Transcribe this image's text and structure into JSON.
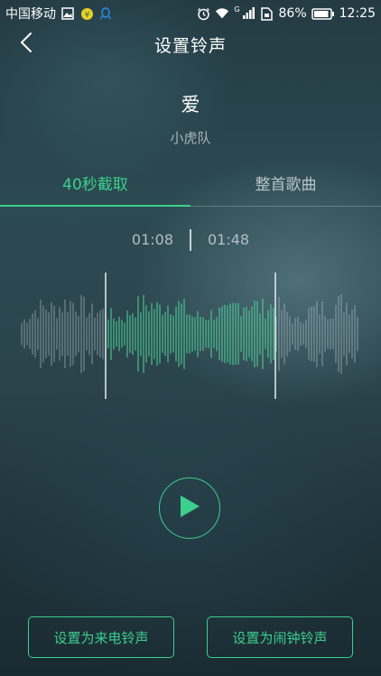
{
  "status_bar": {
    "carrier": "中国移动",
    "battery": "86%",
    "time": "12:25",
    "network_type": "G",
    "icons": [
      "image-icon",
      "coin-icon",
      "qq-icon",
      "alarm-icon",
      "wifi-icon",
      "signal-icon",
      "sim-icon",
      "battery-icon"
    ]
  },
  "nav": {
    "title": "设置铃声",
    "back_icon": "chevron-left-icon"
  },
  "song": {
    "title": "爱",
    "artist": "小虎队"
  },
  "tabs": [
    {
      "label": "40秒截取",
      "active": true
    },
    {
      "label": "整首歌曲",
      "active": false
    }
  ],
  "clip": {
    "start_time": "01:08",
    "end_time": "01:48"
  },
  "play": {
    "icon": "play-icon"
  },
  "actions": {
    "set_call_ringtone": "设置为来电铃声",
    "set_alarm_ringtone": "设置为闹钟铃声"
  },
  "colors": {
    "accent": "#3ccf8e",
    "text": "#ffffff",
    "muted": "#aab6ba"
  }
}
